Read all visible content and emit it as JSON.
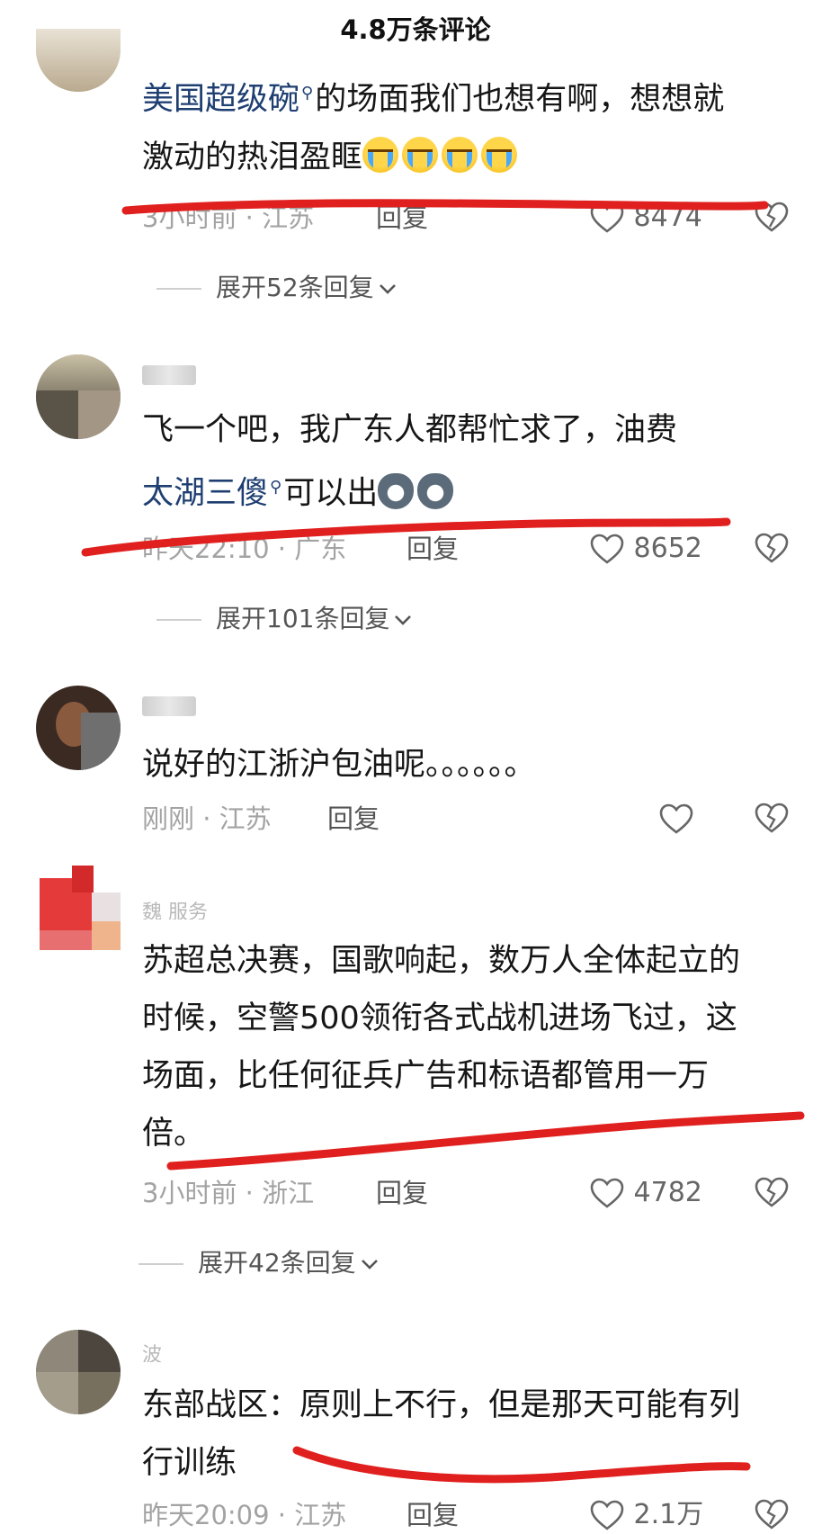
{
  "header": {
    "title": "4.8万条评论"
  },
  "comments": [
    {
      "link": "美国超级碗",
      "text_line1_rest": "的场面我们也想有啊，想想就",
      "text_line2": "激动的热泪盈眶",
      "meta": "3小时前 · 江苏",
      "reply": "回复",
      "likes": "8474",
      "expand": "展开52条回复"
    },
    {
      "username": "·​、、",
      "text_line1": "飞一个吧，我广东人都帮忙求了，油费",
      "link": "太湖三傻",
      "text_line2_rest": "可以出",
      "meta": "昨天22:10 · 广东",
      "reply": "回复",
      "likes": "8652",
      "expand": "展开101条回复"
    },
    {
      "text_line1": "说好的江浙沪包油呢。。。。。。",
      "meta": "刚刚 · 江苏",
      "reply": "回复",
      "likes": ""
    },
    {
      "username": "魏        服务",
      "text_line1": "苏超总决赛，国歌响起，数万人全体起立的",
      "text_line2": "时候，空警500领衔各式战机进场飞过，这",
      "text_line3": "场面，比任何征兵广告和标语都管用一万",
      "text_line4": "倍。",
      "meta": "3小时前 · 浙江",
      "reply": "回复",
      "likes": "4782",
      "expand": "展开42条回复"
    },
    {
      "username": "     波",
      "text_line1": "东部战区：原则上不行，但是那天可能有列",
      "text_line2": "行训练",
      "meta": "昨天20:09 · 江苏",
      "reply": "回复",
      "likes": "2.1万"
    }
  ],
  "colors": {
    "underline": "#e0201e",
    "link": "#1f3f72",
    "meta": "#a3a3a3"
  },
  "icons": [
    "search-icon",
    "heart-icon",
    "broken-heart-icon",
    "chevron-down-icon",
    "cry-emoji",
    "husky-emoji"
  ]
}
